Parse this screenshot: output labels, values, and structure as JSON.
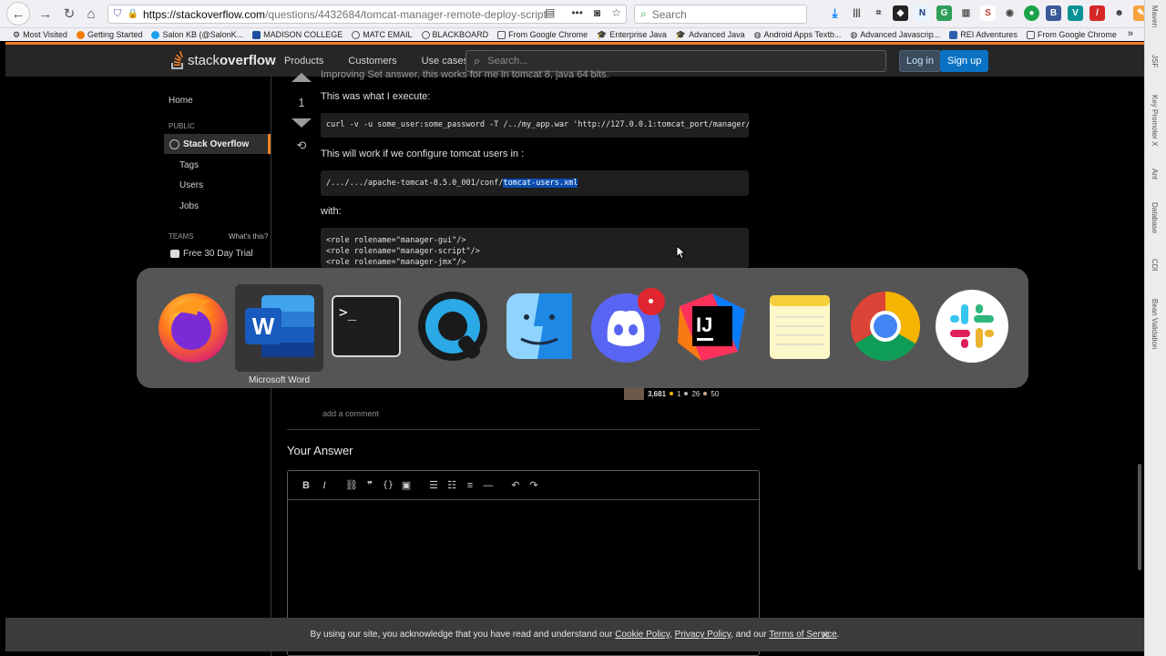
{
  "browser": {
    "url_host": "https://stackoverflow.com",
    "url_path": "/questions/4432684/tomcat-manager-remote-deploy-script",
    "search_placeholder": "Search",
    "bookmarks": [
      "Most Visited",
      "Getting Started",
      "Salon KB (@SalonK...",
      "MADISON COLLEGE",
      "MATC EMAIL",
      "BLACKBOARD",
      "From Google Chrome",
      "Enterprise Java",
      "Advanced Java",
      "Android Apps Textb...",
      "Advanced Javascrip...",
      "REI Adventures",
      "From Google Chrome"
    ]
  },
  "side_panel": {
    "labels": [
      "Maven",
      "JSF",
      "Key Promoter X",
      "Ant",
      "Database",
      "CDI",
      "Bean Validation"
    ]
  },
  "so": {
    "logo_light": "stack",
    "logo_bold": "overflow",
    "nav": [
      "Products",
      "Customers",
      "Use cases"
    ],
    "search_placeholder": "Search...",
    "login": "Log in",
    "signup": "Sign up",
    "left_nav": {
      "home": "Home",
      "public": "PUBLIC",
      "stack_overflow": "Stack Overflow",
      "tags": "Tags",
      "users": "Users",
      "jobs": "Jobs",
      "teams": "TEAMS",
      "whats_this": "What's this?",
      "trial": "Free 30 Day Trial"
    }
  },
  "answer": {
    "top_line": "Improving Set answer, this works for me in tomcat 8, java 64 bits.",
    "vote_count": "1",
    "p1": "This was what I execute:",
    "code1": "curl -v -u some_user:some_password -T /../my_app.war 'http://127.0.0.1:tomcat_port/manager/",
    "p2": "This will work if we configure tomcat users in :",
    "code2_prefix": "/.../.../apache-tomcat-8.5.0_001/conf/",
    "code2_highlight": "tomcat-users.xml",
    "p3": "with:",
    "code3": "<role rolename=\"manager-gui\"/>\n<role rolename=\"manager-script\"/>\n<role rolename=\"manager-jmx\"/>",
    "user_rep": "3,681",
    "badge_gold": "1",
    "badge_silver": "26",
    "badge_bronze": "50",
    "add_comment": "add a comment"
  },
  "your_answer": {
    "heading": "Your Answer",
    "toolbar": [
      "B",
      "I"
    ]
  },
  "cookie": {
    "text_before": "By using our site, you acknowledge that you have read and understand our ",
    "cookie_policy": "Cookie Policy",
    "comma": ", ",
    "privacy_policy": "Privacy Policy",
    "and_our": ", and our ",
    "terms": "Terms of Service",
    "period": ".",
    "close": "✕"
  },
  "switcher": {
    "selected_app": "Microsoft Word",
    "apps": [
      "Firefox",
      "Microsoft Word",
      "Terminal",
      "QuickTime Player",
      "Finder",
      "Discord",
      "IntelliJ IDEA",
      "Notes",
      "Google Chrome",
      "Slack"
    ]
  },
  "colors": {
    "so_orange": "#f48024",
    "so_blue": "#0a72c4",
    "highlight": "#0c4eb0"
  }
}
